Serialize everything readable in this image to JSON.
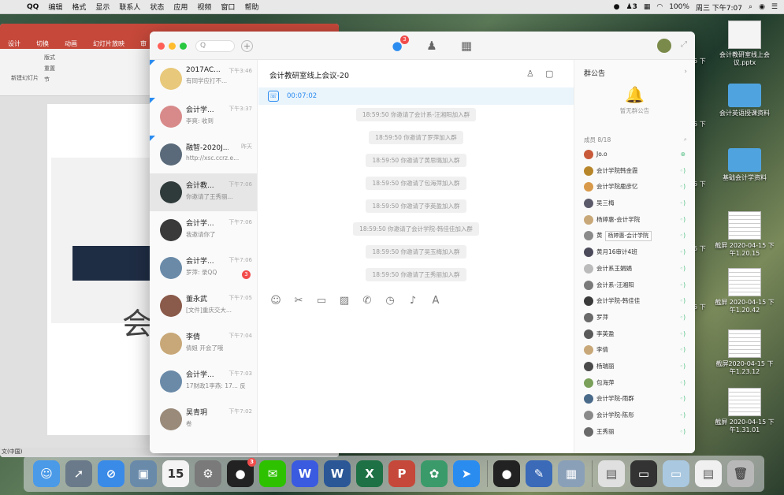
{
  "menubar": {
    "app": "QQ",
    "items": [
      "编辑",
      "格式",
      "显示",
      "联系人",
      "状态",
      "应用",
      "视频",
      "窗口",
      "帮助"
    ],
    "status": {
      "notif_count": "3",
      "battery": "100%",
      "datetime": "周三 下午7:07"
    }
  },
  "desktop": {
    "icons": [
      {
        "label": "会计教研室线上会议.pptx",
        "kind": "doc"
      },
      {
        "label": "会计英语授课资料",
        "kind": "folder"
      },
      {
        "label": "基础会计学资料",
        "kind": "folder"
      },
      {
        "label": "截屏 2020-04-15 下午1.20.15",
        "kind": "sheet"
      },
      {
        "label": "截屏 2020-04-15 下午1.20.42",
        "kind": "sheet"
      },
      {
        "label": "截屏2020-04-15 下午1.23.12",
        "kind": "sheet"
      },
      {
        "label": "截屏 2020-04-15 下午1.31.01",
        "kind": "sheet"
      }
    ],
    "cut_labels": [
      "15 下",
      "15 下",
      "15 下",
      "15 下",
      "15 下"
    ]
  },
  "ppt": {
    "tabs": [
      "设计",
      "切换",
      "动画",
      "幻灯片放映",
      "审"
    ],
    "ribbon": {
      "new_slide": "新建幻灯片",
      "layout": "版式",
      "reset": "重置",
      "section": "节"
    },
    "slide_char": "会",
    "status": "文(中国)"
  },
  "qq": {
    "search_placeholder": "Q",
    "nav": [
      {
        "icon": "chat-icon",
        "badge": "3"
      },
      {
        "icon": "contacts-icon",
        "badge": ""
      },
      {
        "icon": "apps-icon",
        "badge": ""
      }
    ],
    "conversations": [
      {
        "name": "2017AC...",
        "time": "下午3:46",
        "preview": "有同学应打不...",
        "pinned": true,
        "color": "#e8c87a",
        "badge": ""
      },
      {
        "name": "会计学...",
        "time": "下午3:37",
        "preview": "李爽: 收到",
        "pinned": true,
        "color": "#d88a8a",
        "badge": ""
      },
      {
        "name": "融智-2020J...",
        "time": "昨天",
        "preview": "http://xsc.ccrz.e...",
        "pinned": true,
        "color": "#5a6a7a",
        "badge": ""
      },
      {
        "name": "会计教...",
        "time": "下午7:06",
        "preview": "你邀请了王秀丽...",
        "pinned": false,
        "color": "#2f3a3a",
        "badge": "",
        "active": true
      },
      {
        "name": "会计学...",
        "time": "下午7:06",
        "preview": "我邀请你了",
        "pinned": false,
        "color": "#3a3a3a",
        "badge": ""
      },
      {
        "name": "会计学...",
        "time": "下午7:06",
        "preview": "罗萍: 录QQ",
        "pinned": false,
        "color": "#6a8aa8",
        "badge": "3"
      },
      {
        "name": "董永武",
        "time": "下午7:05",
        "preview": "[文件]重庆交大...",
        "pinned": false,
        "color": "#8a5a4a",
        "badge": ""
      },
      {
        "name": "李倩",
        "time": "下午7:04",
        "preview": "倩姐 开会了哦",
        "pinned": false,
        "color": "#c8a878",
        "badge": ""
      },
      {
        "name": "会计学...",
        "time": "下午7:03",
        "preview": "17财政1李燕: 17... 反",
        "pinned": false,
        "color": "#6a8aa8",
        "badge": ""
      },
      {
        "name": "吴青玥",
        "time": "下午7:02",
        "preview": "卷",
        "pinned": false,
        "color": "#9a8a7a",
        "badge": ""
      }
    ],
    "chat": {
      "title": "会计教研室线上会议-20",
      "call_time": "00:07:02",
      "messages": [
        "18:59:50 你邀请了会计系-汪湘阳加入群",
        "18:59:50 你邀请了罗萍加入群",
        "18:59:50 你邀请了黄思璐加入群",
        "18:59:50 你邀请了包海萍加入群",
        "18:59:50 你邀请了李英盈加入群",
        "18:59:50 你邀请了会计学院-韩佳佳加入群",
        "18:59:50 你邀请了吴玉梅加入群",
        "18:59:50 你邀请了王秀丽加入群"
      ],
      "toolbar": [
        "emoji-icon",
        "scissors-icon",
        "folder-icon",
        "image-icon",
        "phone-icon",
        "clock-icon",
        "bell-icon",
        "font-icon"
      ]
    },
    "info": {
      "notice_title": "群公告",
      "no_notice": "暂无群公告",
      "members_label": "成员 8/18",
      "members": [
        {
          "name": "Jo.o",
          "color": "#c85a3a",
          "vol": "⊕"
        },
        {
          "name": "会计学院韩金霞",
          "color": "#b8862a",
          "vol": "◦)"
        },
        {
          "name": "会计学院鹿彦忆",
          "color": "#d89a4a",
          "vol": "◦)"
        },
        {
          "name": "吴三梅",
          "color": "#5a5a6a",
          "vol": "◦)"
        },
        {
          "name": "杨婷惠-会计学院",
          "color": "#c8a878",
          "vol": "◦)"
        },
        {
          "name": "黄",
          "color": "#8a8a8a",
          "vol": "◦)",
          "tooltip": "杨婷惠-会计学院"
        },
        {
          "name": "黄月16审计4班",
          "color": "#4a4a5a",
          "vol": "◦)"
        },
        {
          "name": "会计系王娟娟",
          "color": "#bbbbbb",
          "vol": "◦)"
        },
        {
          "name": "会计系-汪湘阳",
          "color": "#7a7a7a",
          "vol": "◦)"
        },
        {
          "name": "会计学院-韩佳佳",
          "color": "#3a3a3a",
          "vol": "◦)"
        },
        {
          "name": "罗萍",
          "color": "#6a6a6a",
          "vol": "◦)"
        },
        {
          "name": "李英盈",
          "color": "#5a5a5a",
          "vol": "◦)"
        },
        {
          "name": "李倩",
          "color": "#c8a878",
          "vol": "◦)"
        },
        {
          "name": "杨瑞丽",
          "color": "#4a4a4a",
          "vol": "◦)"
        },
        {
          "name": "包海萍",
          "color": "#7aa05a",
          "vol": "◦)"
        },
        {
          "name": "会计学院-雨群",
          "color": "#4a6a8a",
          "vol": "◦)"
        },
        {
          "name": "会计学院-陈彤",
          "color": "#8a8a8a",
          "vol": "◦)"
        },
        {
          "name": "王秀丽",
          "color": "#6a6a6a",
          "vol": "◦)"
        }
      ]
    }
  },
  "dock": {
    "apps": [
      {
        "name": "finder-icon",
        "color": "#4a9ae8",
        "glyph": "☺"
      },
      {
        "name": "launchpad-icon",
        "color": "#6a7a8a",
        "glyph": "➚"
      },
      {
        "name": "safari-icon",
        "color": "#3a8ae8",
        "glyph": "⊘"
      },
      {
        "name": "preview-icon",
        "color": "#6a8aaa",
        "glyph": "▣"
      },
      {
        "name": "calendar-icon",
        "color": "#f4f4f4",
        "glyph": "15",
        "textColor": "#333"
      },
      {
        "name": "system-preferences-icon",
        "color": "#7a7a7a",
        "glyph": "⚙"
      },
      {
        "name": "qq-dock-icon",
        "color": "#222",
        "glyph": "●",
        "badge": "3"
      },
      {
        "name": "wechat-icon",
        "color": "#2dc100",
        "glyph": "✉"
      },
      {
        "name": "wps-icon",
        "color": "#3a5ae0",
        "glyph": "W"
      },
      {
        "name": "word-icon",
        "color": "#2b5797",
        "glyph": "W"
      },
      {
        "name": "excel-icon",
        "color": "#1e7145",
        "glyph": "X"
      },
      {
        "name": "powerpoint-icon",
        "color": "#c5483a",
        "glyph": "P"
      },
      {
        "name": "pinwheel-icon",
        "color": "#3a9a6a",
        "glyph": "✿"
      },
      {
        "name": "tencent-meeting-icon",
        "color": "#2b8cf0",
        "glyph": "➤"
      }
    ],
    "others": [
      {
        "name": "qq-penguin-icon",
        "color": "#222",
        "glyph": "●"
      },
      {
        "name": "memo-icon",
        "color": "#3a6ab8",
        "glyph": "✎"
      },
      {
        "name": "photo-icon",
        "color": "#8aa0b8",
        "glyph": "▦"
      }
    ],
    "files": [
      {
        "name": "document-stack-icon",
        "color": "#e0e0e0",
        "glyph": "▤",
        "textColor": "#555"
      },
      {
        "name": "screenshot-stack-icon",
        "color": "#333",
        "glyph": "▭"
      },
      {
        "name": "screenshot-stack-icon-2",
        "color": "#aac8e0",
        "glyph": "▭"
      },
      {
        "name": "files-stack-icon",
        "color": "#f0f0f0",
        "glyph": "▤",
        "textColor": "#555"
      },
      {
        "name": "trash-icon",
        "color": "#b8b8b8",
        "glyph": "🗑",
        "textColor": "#555"
      }
    ]
  }
}
